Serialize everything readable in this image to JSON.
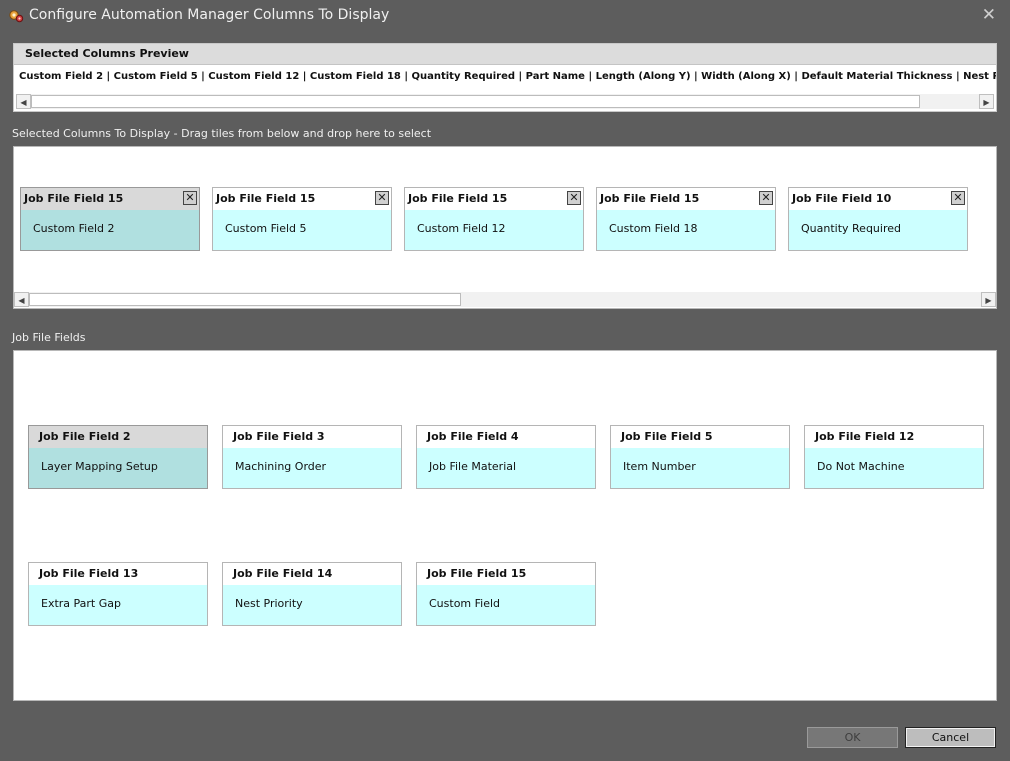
{
  "window": {
    "title": "Configure Automation Manager Columns To Display",
    "close_glyph": "✕",
    "icon": "app-gear-icon"
  },
  "preview": {
    "header": "Selected Columns Preview",
    "text": "Custom Field 2 | Custom Field 5 | Custom Field 12 | Custom Field 18 | Quantity Required | Part Name | Length (Along Y) | Width (Along X) | Default Material Thickness | Nest Part Rotation Method"
  },
  "selected": {
    "label": "Selected Columns To Display - Drag tiles from below and drop here to select",
    "remove_glyph": "✕",
    "tiles": [
      {
        "header": "Job File Field 15",
        "value": "Custom Field 2"
      },
      {
        "header": "Job File Field 15",
        "value": "Custom Field 5"
      },
      {
        "header": "Job File Field 15",
        "value": "Custom Field 12"
      },
      {
        "header": "Job File Field 15",
        "value": "Custom Field 18"
      },
      {
        "header": "Job File Field 10",
        "value": "Quantity Required"
      }
    ]
  },
  "fields": {
    "label": "Job File Fields",
    "tiles": [
      {
        "header": "Job File Field 2",
        "value": "Layer Mapping Setup"
      },
      {
        "header": "Job File Field 3",
        "value": "Machining Order"
      },
      {
        "header": "Job File Field 4",
        "value": "Job File Material"
      },
      {
        "header": "Job File Field 5",
        "value": "Item Number"
      },
      {
        "header": "Job File Field 12",
        "value": "Do Not Machine"
      },
      {
        "header": "Job File Field 13",
        "value": "Extra Part Gap"
      },
      {
        "header": "Job File Field 14",
        "value": "Nest Priority"
      },
      {
        "header": "Job File Field 15",
        "value": "Custom Field"
      }
    ]
  },
  "scroll": {
    "left_glyph": "◀",
    "right_glyph": "▶"
  },
  "buttons": {
    "ok": "OK",
    "cancel": "Cancel"
  }
}
